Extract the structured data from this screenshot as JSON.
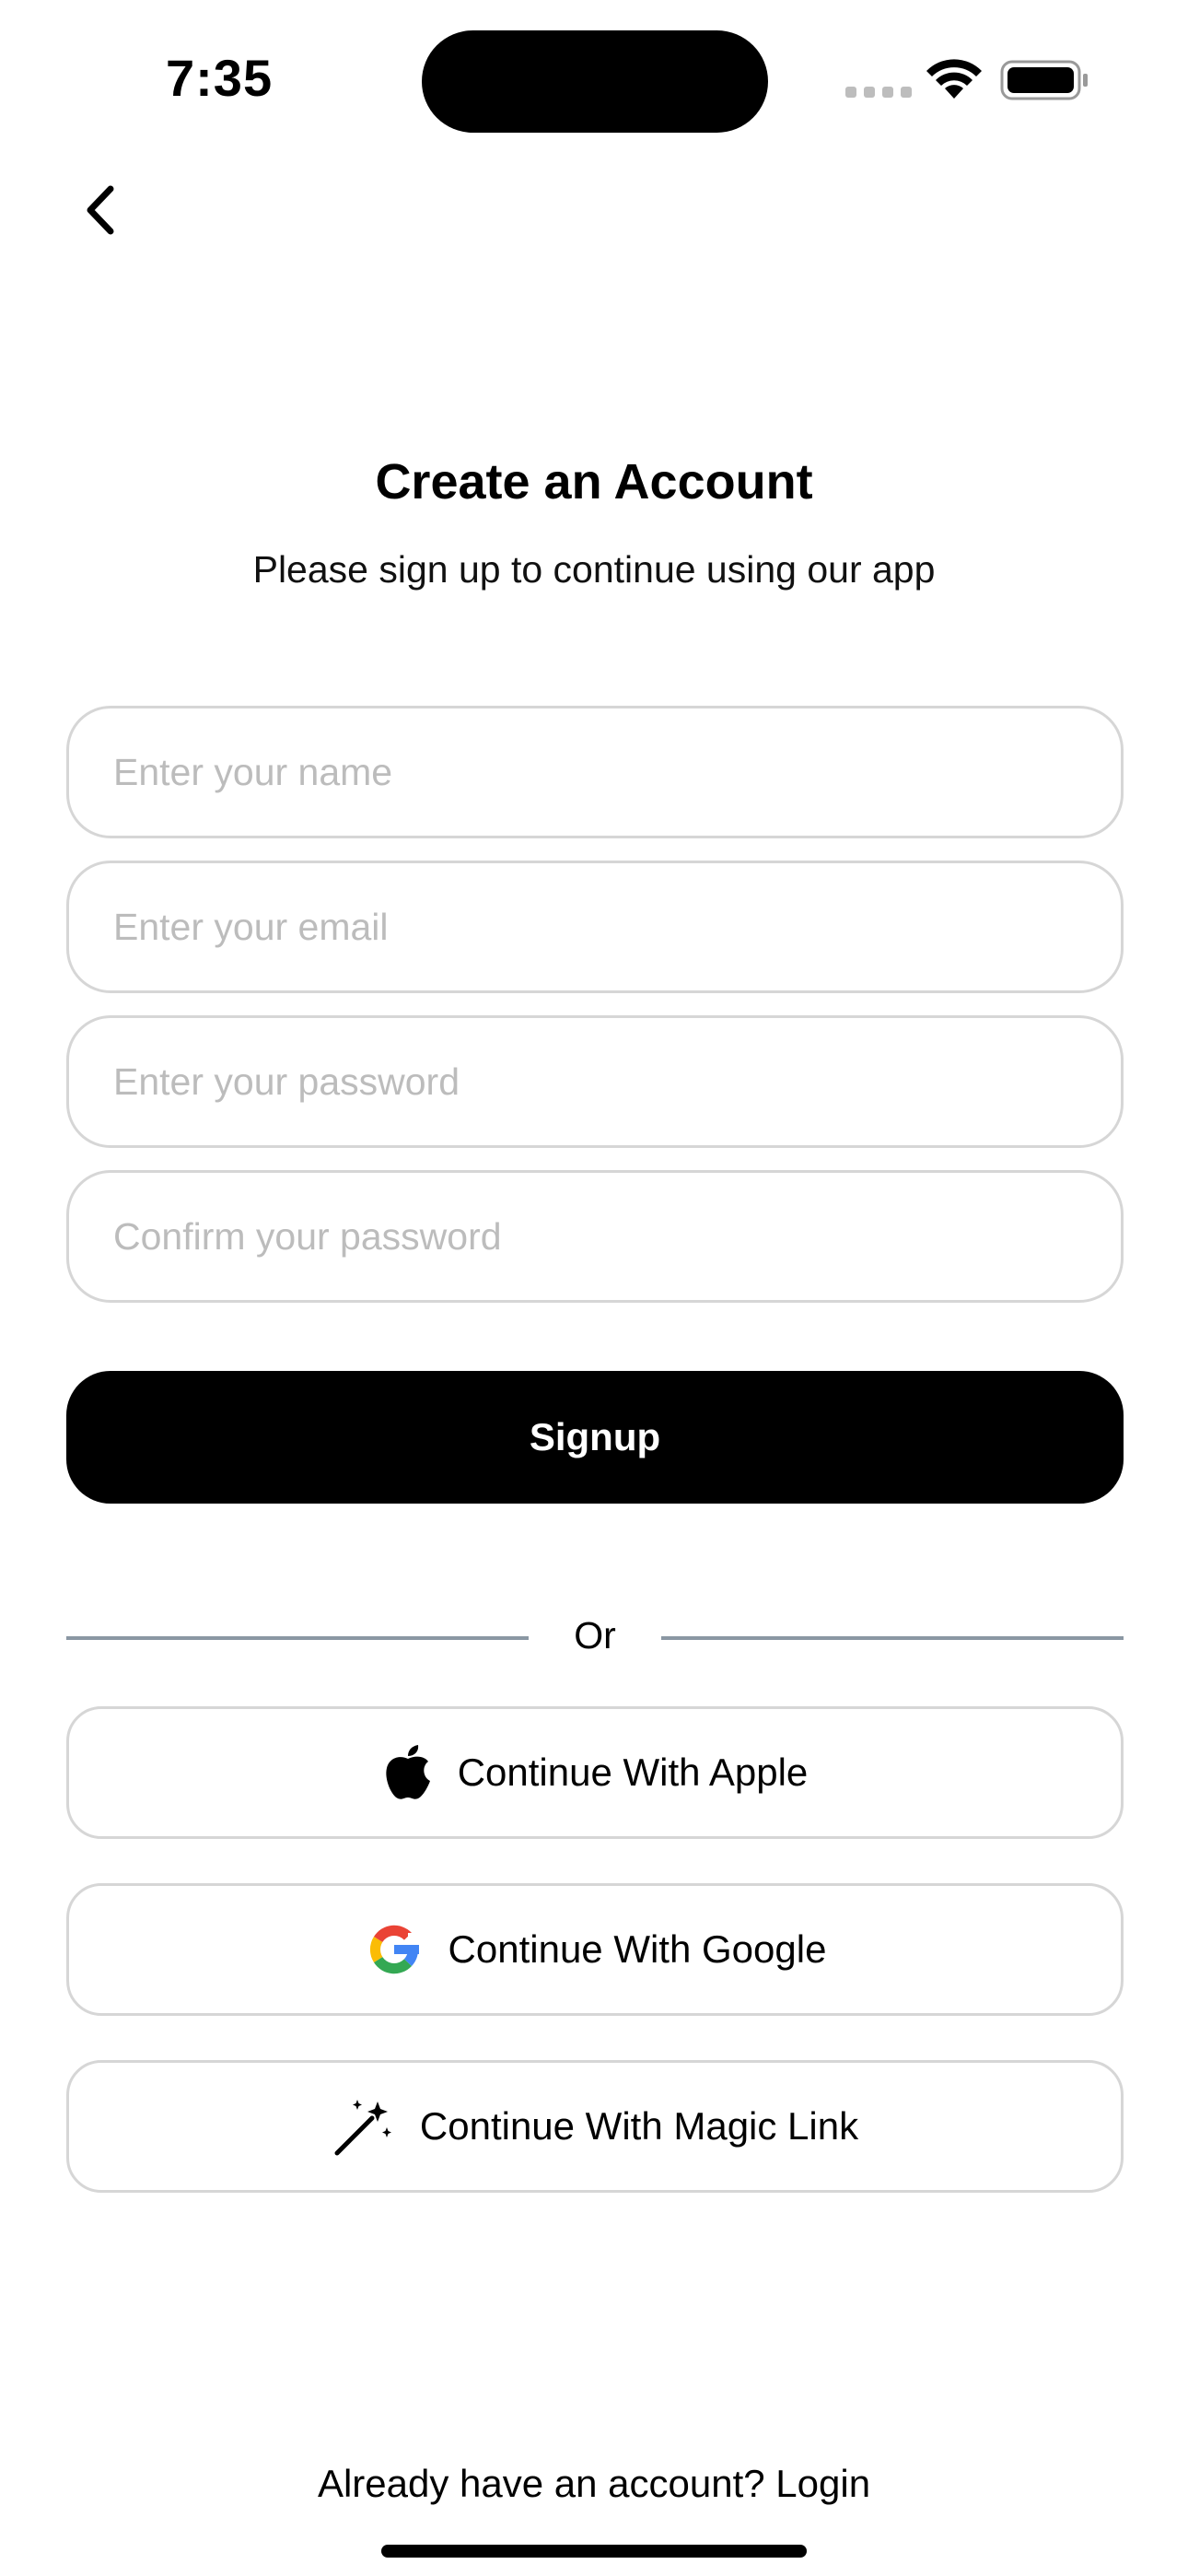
{
  "status_bar": {
    "time": "7:35"
  },
  "header": {
    "back_icon": "chevron-left-icon",
    "title": "Create an Account",
    "subtitle": "Please sign up to continue using our app"
  },
  "form": {
    "name_placeholder": "Enter your name",
    "name_value": "",
    "email_placeholder": "Enter your email",
    "email_value": "",
    "password_placeholder": "Enter your password",
    "password_value": "",
    "confirm_placeholder": "Confirm your password",
    "confirm_value": "",
    "submit_label": "Signup"
  },
  "divider": {
    "label": "Or"
  },
  "social": [
    {
      "label": "Continue With Apple",
      "icon": "apple-icon"
    },
    {
      "label": "Continue With Google",
      "icon": "google-icon"
    },
    {
      "label": "Continue With Magic Link",
      "icon": "magic-wand-icon"
    }
  ],
  "footer": {
    "prompt": "Already have an account?",
    "link": "Login"
  },
  "colors": {
    "primary": "#000000",
    "border": "#d6d6d6",
    "placeholder": "#bcbcbc",
    "divider": "#8a97a3"
  }
}
